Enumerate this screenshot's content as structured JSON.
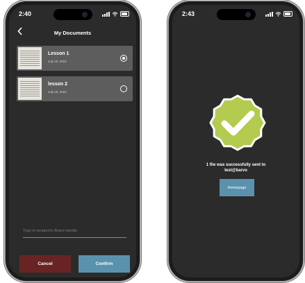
{
  "colors": {
    "success_badge": "#b3cb4f",
    "confirm_button": "#5a92ad",
    "cancel_button": "#6a2323"
  },
  "left_phone": {
    "status_time": "2:40",
    "header": {
      "title": "My Documents",
      "back_icon": "chevron-left-icon"
    },
    "documents": [
      {
        "title": "Lesson 1",
        "date": "July 25, 2024",
        "selected": true
      },
      {
        "title": "lesson 2",
        "date": "July 25, 2024",
        "selected": false
      }
    ],
    "recipient_placeholder": "Type in recipient's Bravo handle",
    "cancel_label": "Cancel",
    "confirm_label": "Confirm"
  },
  "right_phone": {
    "status_time": "2:43",
    "success_message_line1": "1 file was successfully sent to",
    "success_message_line2": "test@barvo",
    "homepage_label": "Homepage",
    "success_icon": "checkmark-badge-icon"
  }
}
